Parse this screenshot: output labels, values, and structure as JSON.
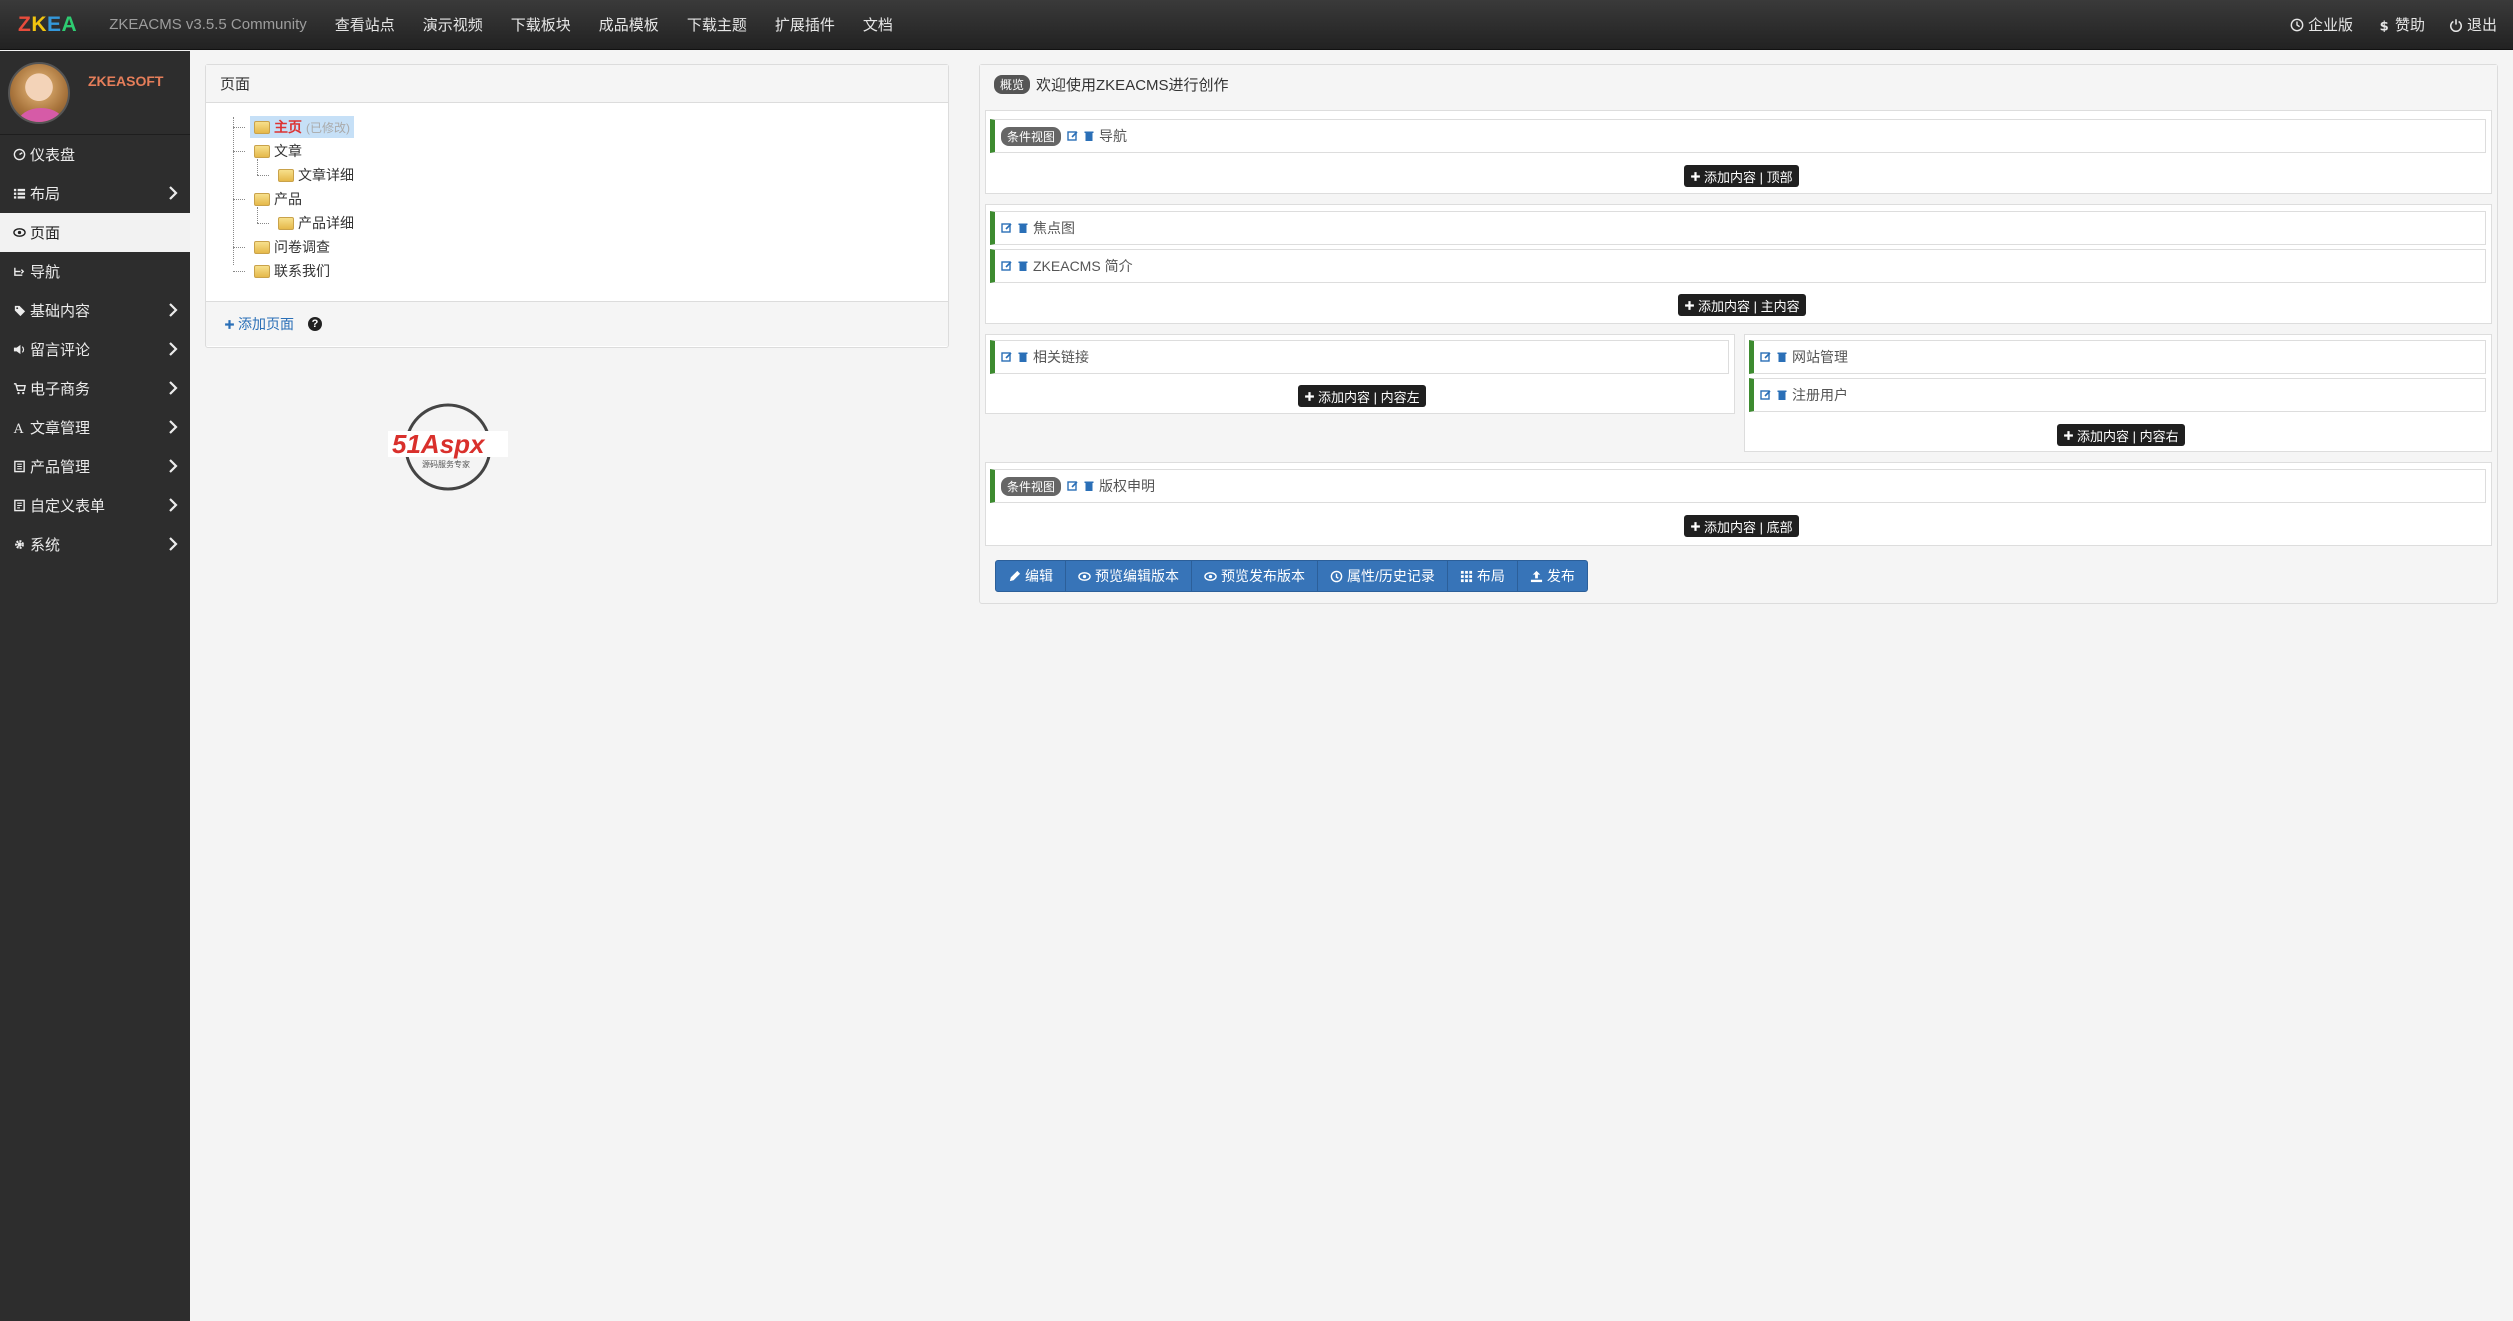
{
  "topbar": {
    "brand": [
      "Z",
      "K",
      "E",
      "A"
    ],
    "version": "ZKEACMS v3.5.5 Community",
    "nav": [
      "查看站点",
      "演示视频",
      "下载板块",
      "成品模板",
      "下载主题",
      "扩展插件",
      "文档"
    ],
    "right": [
      {
        "label": "企业版",
        "icon": "clock-icon"
      },
      {
        "label": "赞助",
        "icon": "dollar-icon"
      },
      {
        "label": "退出",
        "icon": "power-icon"
      }
    ]
  },
  "sidebar": {
    "username": "ZKEASOFT",
    "items": [
      {
        "label": "仪表盘",
        "icon": "dashboard-icon",
        "chevron": false,
        "active": false
      },
      {
        "label": "布局",
        "icon": "list-icon",
        "chevron": true,
        "active": false
      },
      {
        "label": "页面",
        "icon": "eye-icon",
        "chevron": false,
        "active": true
      },
      {
        "label": "导航",
        "icon": "sitemap-icon",
        "chevron": false,
        "active": false
      },
      {
        "label": "基础内容",
        "icon": "tag-icon",
        "chevron": true,
        "active": false
      },
      {
        "label": "留言评论",
        "icon": "volume-icon",
        "chevron": true,
        "active": false
      },
      {
        "label": "电子商务",
        "icon": "cart-icon",
        "chevron": true,
        "active": false
      },
      {
        "label": "文章管理",
        "icon": "font-icon",
        "chevron": true,
        "active": false
      },
      {
        "label": "产品管理",
        "icon": "book-icon",
        "chevron": true,
        "active": false
      },
      {
        "label": "自定义表单",
        "icon": "form-icon",
        "chevron": true,
        "active": false
      },
      {
        "label": "系统",
        "icon": "cog-icon",
        "chevron": true,
        "active": false
      }
    ]
  },
  "pages_panel": {
    "title": "页面",
    "tree": {
      "home": "主页",
      "home_status": "(已修改)",
      "article": "文章",
      "article_detail": "文章详细",
      "product": "产品",
      "product_detail": "产品详细",
      "survey": "问卷调查",
      "contact": "联系我们"
    },
    "add_page": "添加页面"
  },
  "layout_panel": {
    "badge": "概览",
    "title": "欢迎使用ZKEACMS进行创作",
    "cond_label": "条件视图",
    "widgets": {
      "nav": "导航",
      "focus": "焦点图",
      "intro": "ZKEACMS 简介",
      "links": "相关链接",
      "site_admin": "网站管理",
      "register": "注册用户",
      "copyright": "版权申明"
    },
    "add_buttons": {
      "top": "添加内容 | 顶部",
      "main": "添加内容 | 主内容",
      "left": "添加内容 | 内容左",
      "right": "添加内容 | 内容右",
      "bottom": "添加内容 | 底部"
    },
    "toolbar": [
      {
        "label": "编辑",
        "icon": "pencil-icon"
      },
      {
        "label": "预览编辑版本",
        "icon": "eye-icon"
      },
      {
        "label": "预览发布版本",
        "icon": "eye-icon"
      },
      {
        "label": "属性/历史记录",
        "icon": "clock-icon"
      },
      {
        "label": "布局",
        "icon": "grid-icon"
      },
      {
        "label": "发布",
        "icon": "upload-icon"
      }
    ]
  },
  "logo_text": {
    "main": "51Aspx",
    "sub": "源码服务专家"
  }
}
